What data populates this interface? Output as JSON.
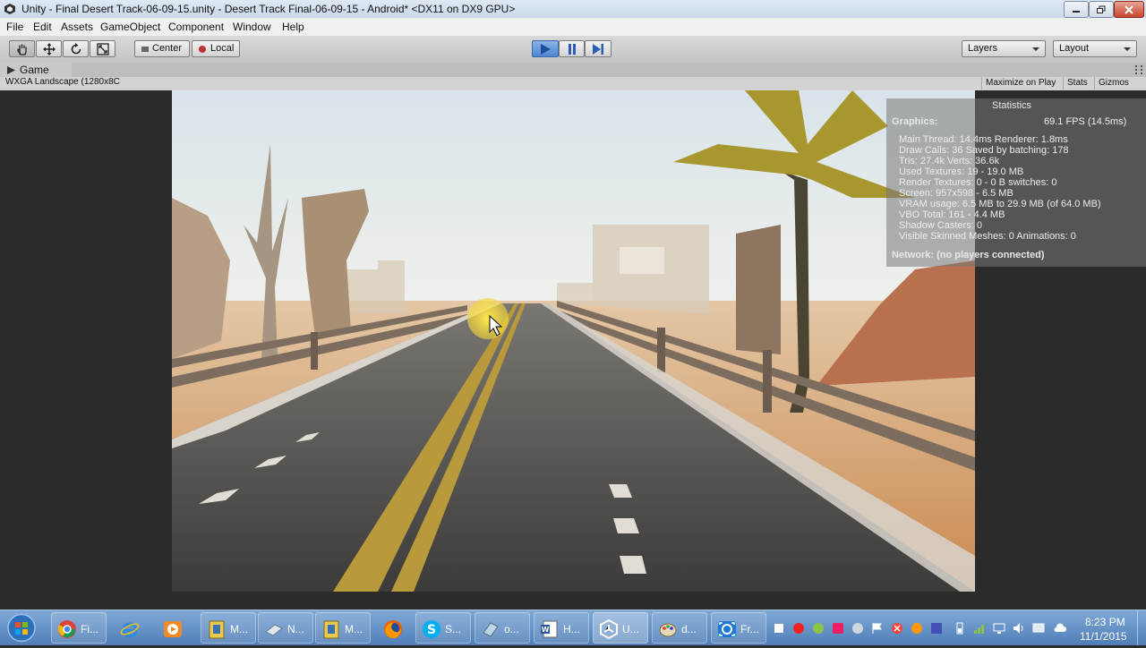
{
  "window": {
    "title": "Unity - Final Desert Track-06-09-15.unity - Desert Track Final-06-09-15 - Android* <DX11 on DX9 GPU>"
  },
  "menu": [
    "File",
    "Edit",
    "Assets",
    "GameObject",
    "Component",
    "Window",
    "Help"
  ],
  "toolbar": {
    "pivot_label": "Center",
    "space_label": "Local",
    "layers_label": "Layers",
    "layout_label": "Layout"
  },
  "game_tab": {
    "label": "Game",
    "aspect": "WXGA Landscape (1280x8C",
    "maximize": "Maximize on Play",
    "stats": "Stats",
    "gizmos": "Gizmos"
  },
  "statistics": {
    "header": "Statistics",
    "graphics_label": "Graphics:",
    "fps": "69.1 FPS (14.5ms)",
    "lines": [
      "Main Thread: 14.4ms  Renderer: 1.8ms",
      "Draw Calls: 36    Saved by batching: 178",
      "Tris: 27.4k   Verts: 36.6k",
      "Used Textures: 19 - 19.0 MB",
      "Render Textures: 0 - 0 B   switches: 0",
      "Screen: 957x598 - 6.5 MB",
      "VRAM usage: 6.5 MB to 29.9 MB (of 64.0 MB)",
      "VBO Total: 161 - 4.4 MB",
      "Shadow Casters: 0",
      "Visible Skinned Meshes: 0       Animations: 0"
    ],
    "network": "Network: (no players connected)"
  },
  "taskbar": {
    "tasks": [
      "Fi...",
      "M...",
      "N...",
      "M...",
      "S...",
      "o...",
      "H...",
      "U...",
      "d...",
      "Fr..."
    ],
    "time": "8:23 PM",
    "date": "11/1/2015"
  },
  "colors": {
    "sky": "#e9eef0",
    "sand": "#d9a46c",
    "road": "#4a4846",
    "accent_play": "#4e85d1",
    "taskbar": "#5d8cc4"
  }
}
